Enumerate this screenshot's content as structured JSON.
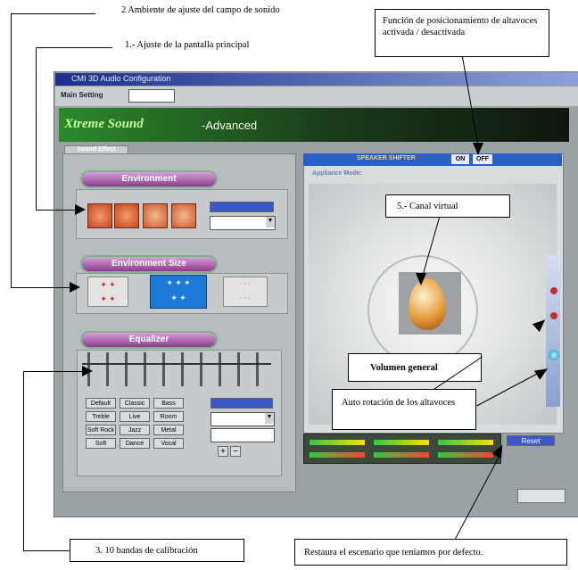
{
  "annotations": {
    "sound_field": "2 Ambiente de ajuste del campo de sonido",
    "main_screen": "1.- Ajuste de la pantalla principal",
    "speaker_positioning": "Función  de posicionamiento de altavoces activada / desactivada",
    "virtual_channel": "5.- Canal virtual",
    "general_volume": "Volumen general",
    "auto_rotation": "Auto rotación de los altavoces",
    "calibration": "3. 10 bandas de calibración",
    "reset_default": "Restaura el escenario que teniamos por defecto."
  },
  "window": {
    "title": "CMI 3D Audio Configuration",
    "main_setting_label": "Main Setting",
    "banner_suffix": "-Advanced",
    "sound_effect_tab": "Sound Effect",
    "environment_header": "Environment",
    "environment_size_header": "Environment Size",
    "equalizer_header": "Equalizer",
    "speaker_status": "SPEAKER SHIFTER",
    "on_label": "ON",
    "off_label": "OFF",
    "appliance_mode": "Appliance Mode:",
    "reset_label": "Reset",
    "eq_presets": [
      "Default",
      "Classic",
      "Bass",
      "Treble",
      "Live",
      "Room",
      "Soft Rock",
      "Jazz",
      "Metal",
      "Soft",
      "Dance",
      "Vocal"
    ]
  }
}
